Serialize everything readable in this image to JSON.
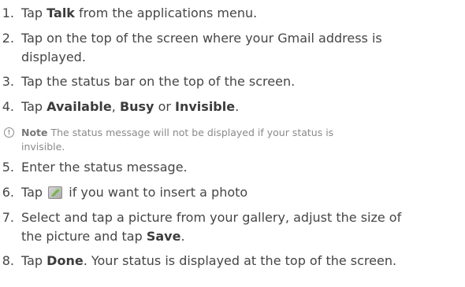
{
  "steps": [
    {
      "num": "1.",
      "pre": "Tap ",
      "bold": "Talk",
      "post": " from the applications menu."
    },
    {
      "num": "2.",
      "line1": "Tap on the top of the screen where your Gmail address is",
      "line2": "displayed."
    },
    {
      "num": "3.",
      "text": "Tap the status bar on the top of the screen."
    },
    {
      "num": "4.",
      "pre": "Tap ",
      "bold1": "Available",
      "sep1": ", ",
      "bold2": "Busy",
      "sep2": " or ",
      "bold3": "Invisible",
      "post": "."
    },
    {
      "num": "5.",
      "text": "Enter the status message."
    },
    {
      "num": "6.",
      "pre": "Tap ",
      "icon": "photo-icon",
      "post": " if you want to insert a photo"
    },
    {
      "num": "7.",
      "line1": "Select and tap a picture from your gallery, adjust the size of",
      "line2_pre": "the picture and tap ",
      "line2_bold": "Save",
      "line2_post": "."
    },
    {
      "num": "8.",
      "pre": "Tap ",
      "bold": "Done",
      "post": ". Your status is displayed at the top of the screen."
    }
  ],
  "note": {
    "icon": "info-icon",
    "icon_glyph": "!",
    "label": "Note",
    "line1": " The status message will not be displayed if your status is",
    "line2": "invisible."
  }
}
